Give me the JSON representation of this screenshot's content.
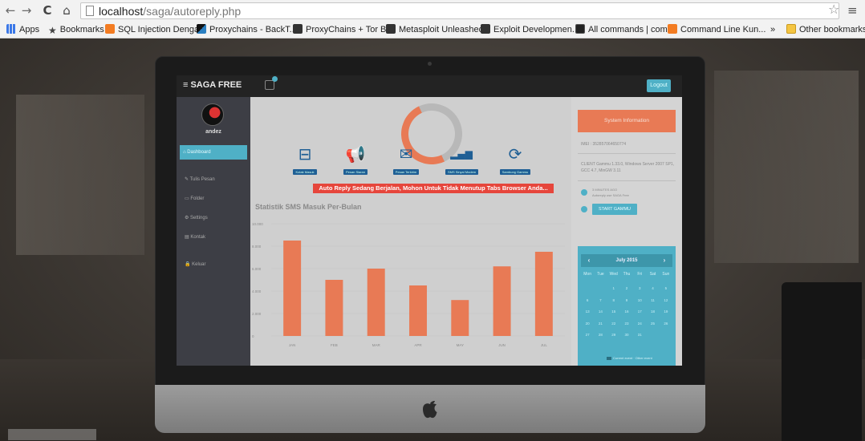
{
  "browser": {
    "back": "←",
    "forward": "→",
    "reload": "C",
    "home": "⌂",
    "url_host": "localhost",
    "url_path": "/saga/autoreply.php",
    "star": "☆",
    "menu": "≡",
    "bookmarks": [
      {
        "label": "Apps",
        "icon": "apps-grid-icon"
      },
      {
        "label": "Bookmarks",
        "icon": "star-icon"
      },
      {
        "label": "SQL Injection Denga...",
        "icon": "blogger-icon"
      },
      {
        "label": "Proxychains - BackT...",
        "icon": "kali-icon"
      },
      {
        "label": "ProxyChains + Tor B...",
        "icon": "site-icon"
      },
      {
        "label": "Metasploit Unleashed",
        "icon": "offsec-icon"
      },
      {
        "label": "Exploit Developmen...",
        "icon": "offsec-icon"
      },
      {
        "label": "All commands | com...",
        "icon": "terminal-icon"
      },
      {
        "label": "Command Line Kun...",
        "icon": "blogger-icon"
      },
      {
        "label": "»",
        "icon": "overflow-icon"
      },
      {
        "label": "Other bookmarks",
        "icon": "folder-icon"
      }
    ]
  },
  "app": {
    "brand": "≡  SAGA FREE",
    "logout": "Logout",
    "username": "andez",
    "menu": [
      {
        "label": "⌂  Dashboard",
        "active": true
      },
      {
        "label": "✎  Tulis Pesan",
        "active": false
      },
      {
        "label": "▭  Folder",
        "active": false
      },
      {
        "label": "⚙  Settings",
        "active": false
      },
      {
        "label": "▤  Kontak",
        "active": false
      },
      {
        "label": "🔒  Keluar",
        "active": false
      }
    ],
    "quick": [
      {
        "label": "Kotak Masuk",
        "glyph": "⊟"
      },
      {
        "label": "Pesan Siaran",
        "glyph": "📢"
      },
      {
        "label": "Pesan Terkirim",
        "glyph": "✉"
      },
      {
        "label": "SMS Sinyal Modem",
        "glyph": "▂▄▆"
      },
      {
        "label": "Sambung Gammu",
        "glyph": "⟳"
      }
    ],
    "alert": "Auto Reply Sedang Berjalan, Mohon Untuk Tidak Menutup Tabs Browser Anda...",
    "chart_title": "Statistik SMS Masuk Per-Bulan",
    "right": {
      "sysinfo": "System Information",
      "imei": "IMEI : 352857064650774",
      "client": "CLIENT Gammu 1.33.0, Windows Server 2007 SP1, GCC 4.7, MinGW 3.11",
      "status_line1": "3 MINUTES AGO",
      "status_line2": "Autoreply use SAGA Free",
      "start_gammu": "START GAMMU"
    },
    "calendar": {
      "month": "July 2015",
      "prev": "‹",
      "next": "›",
      "days": [
        "Mon",
        "Tue",
        "Wed",
        "Thu",
        "Fri",
        "Sat",
        "Sun"
      ],
      "dates": [
        "",
        "",
        "1",
        "2",
        "3",
        "4",
        "5",
        "6",
        "7",
        "8",
        "9",
        "10",
        "11",
        "12",
        "13",
        "14",
        "15",
        "16",
        "17",
        "18",
        "19",
        "20",
        "21",
        "22",
        "23",
        "24",
        "25",
        "26",
        "27",
        "28",
        "29",
        "30",
        "31",
        "",
        ""
      ],
      "footer": "Current event  ·  Other event"
    }
  },
  "chart_data": {
    "type": "bar",
    "title": "Statistik SMS Masuk Per-Bulan",
    "categories": [
      "JAN",
      "FEB",
      "MAR",
      "APR",
      "MAY",
      "JUN",
      "JUL"
    ],
    "values": [
      8500,
      5000,
      6000,
      4500,
      3200,
      6200,
      7500
    ],
    "yticks": [
      0,
      2000,
      4000,
      6000,
      8000,
      10000
    ],
    "ytick_labels": [
      "0",
      "2.000",
      "4.000",
      "6.000",
      "8.000",
      "10.000"
    ],
    "ylim": [
      0,
      10000
    ],
    "color": "#e87a55",
    "grid": true
  },
  "colors": {
    "accent": "#4fb0c6",
    "orange": "#e87a55",
    "alert": "#e6463c",
    "sidebar": "#3d3e45"
  }
}
